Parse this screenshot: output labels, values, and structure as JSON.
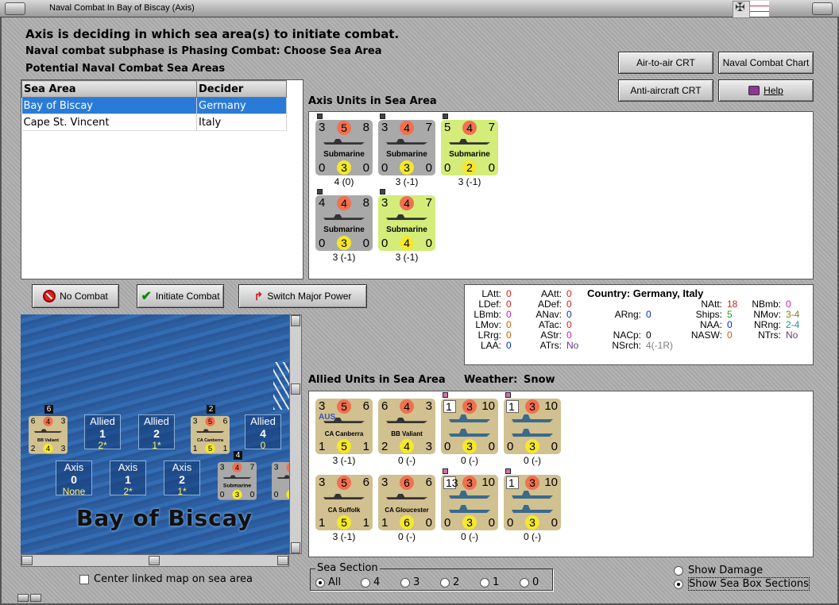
{
  "window": {
    "title": "Naval Combat In Bay of Biscay (Axis)"
  },
  "header": {
    "line1": "Axis is deciding in which sea area(s) to initiate combat.",
    "line2": "Naval combat subphase is Phasing Combat: Choose Sea Area",
    "line3": "Potential Naval Combat Sea Areas"
  },
  "crt_buttons": {
    "air_to_air": "Air-to-air CRT",
    "naval_chart": "Naval Combat Chart",
    "anti_aircraft": "Anti-aircraft CRT",
    "help": "Help"
  },
  "sea_table": {
    "headers": [
      "Sea Area",
      "Decider"
    ],
    "rows": [
      {
        "area": "Bay of Biscay",
        "decider": "Germany",
        "selected": true
      },
      {
        "area": "Cape St. Vincent",
        "decider": "Italy",
        "selected": false
      }
    ]
  },
  "axis_units": {
    "label": "Axis Units in Sea Area",
    "units": [
      {
        "color": "grey",
        "tl": "3",
        "top": "5",
        "tr": "8",
        "name": "Submarine",
        "bl": "0",
        "bottom": "3",
        "br": "0",
        "caption": "4 (0)"
      },
      {
        "color": "grey",
        "tl": "3",
        "top": "4",
        "tr": "7",
        "name": "Submarine",
        "bl": "0",
        "bottom": "3",
        "br": "0",
        "caption": "3 (-1)"
      },
      {
        "color": "lime",
        "tl": "5",
        "top": "4",
        "tr": "7",
        "name": "Submarine",
        "bl": "0",
        "bottom": "2",
        "br": "0",
        "caption": "3 (-1)"
      },
      {
        "color": "grey",
        "tl": "4",
        "top": "4",
        "tr": "8",
        "name": "Submarine",
        "bl": "0",
        "bottom": "3",
        "br": "0",
        "caption": "3 (-1)"
      },
      {
        "color": "lime",
        "tl": "3",
        "top": "4",
        "tr": "7",
        "name": "Submarine",
        "bl": "0",
        "bottom": "4",
        "br": "0",
        "caption": "3 (-1)"
      }
    ]
  },
  "action_buttons": {
    "no_combat": "No Combat",
    "initiate": "Initiate Combat",
    "switch": "Switch Major Power"
  },
  "stats": {
    "country": "Country: Germany, Italy",
    "col1": [
      {
        "k": "LAtt:",
        "v": "0",
        "c": "#d02020"
      },
      {
        "k": "LDef:",
        "v": "0",
        "c": "#d02020"
      },
      {
        "k": "LBmb:",
        "v": "0",
        "c": "#c020c0"
      },
      {
        "k": "LMov:",
        "v": "0",
        "c": "#c06000"
      },
      {
        "k": "LRrg:",
        "v": "0",
        "c": "#c06000"
      },
      {
        "k": "LAA:",
        "v": "0",
        "c": "#0030c0"
      }
    ],
    "col2": [
      {
        "k": "AAtt:",
        "v": "0",
        "c": "#d02020"
      },
      {
        "k": "ADef:",
        "v": "0",
        "c": "#d02020"
      },
      {
        "k": "ANav:",
        "v": "0",
        "c": "#0030c0"
      },
      {
        "k": "ATac:",
        "v": "0",
        "c": "#d02020"
      },
      {
        "k": "AStr:",
        "v": "0",
        "c": "#c020c0"
      },
      {
        "k": "ATrs:",
        "v": "No",
        "c": "#604080"
      }
    ],
    "col3": [
      {
        "k": "ARng:",
        "v": "0",
        "c": "#0030c0"
      },
      {
        "k": "NACp:",
        "v": "0",
        "c": "#000"
      },
      {
        "k": "NSrch:",
        "v": "4(-1R)",
        "c": "#808080"
      }
    ],
    "col4": [
      {
        "k": "NAtt:",
        "v": "18",
        "c": "#d02020"
      },
      {
        "k": "Ships:",
        "v": "5",
        "c": "#20a020"
      },
      {
        "k": "NAA:",
        "v": "0",
        "c": "#0030c0"
      },
      {
        "k": "NASW:",
        "v": "0",
        "c": "#c06000"
      }
    ],
    "col5": [
      {
        "k": "NBmb:",
        "v": "0",
        "c": "#c020c0"
      },
      {
        "k": "NMov:",
        "v": "3-4",
        "c": "#808020"
      },
      {
        "k": "NRng:",
        "v": "2-4",
        "c": "#209090"
      },
      {
        "k": "NTrs:",
        "v": "No",
        "c": "#604080"
      }
    ]
  },
  "allied_units": {
    "label": "Allied Units in Sea Area",
    "weather_label": "Weather:",
    "weather": "Snow",
    "units": [
      {
        "type": "ship",
        "tl": "3",
        "top": "5",
        "tr": "6",
        "name": "CA Canberra",
        "aus": "AUS",
        "bl": "1",
        "bottom": "5",
        "br": "1",
        "caption": "3 (-1)"
      },
      {
        "type": "ship",
        "tl": "6",
        "top": "4",
        "tr": "3",
        "name": "BB Valiant",
        "bl": "2",
        "bottom": "4",
        "br": "3",
        "caption": "0 (-)"
      },
      {
        "type": "convoy",
        "tl": "1",
        "top": "3",
        "tr": "10",
        "bl": "0",
        "bottom": "3",
        "br": "0",
        "caption": "0 (-)"
      },
      {
        "type": "convoy",
        "tl": "1",
        "top": "3",
        "tr": "10",
        "bl": "0",
        "bottom": "3",
        "br": "0",
        "caption": "0 (-)"
      },
      {
        "type": "ship",
        "tl": "3",
        "top": "5",
        "tr": "6",
        "name": "CA Suffolk",
        "bl": "1",
        "bottom": "5",
        "br": "1",
        "caption": "3 (-1)"
      },
      {
        "type": "ship",
        "tl": "3",
        "top": "6",
        "tr": "6",
        "name": "CA Gloucester",
        "bl": "1",
        "bottom": "6",
        "br": "0",
        "caption": "0 (-)"
      },
      {
        "type": "convoy",
        "tl": "13",
        "top": "3",
        "tr": "10",
        "bl": "0",
        "bottom": "3",
        "br": "0",
        "caption": "0 (-)"
      },
      {
        "type": "convoy",
        "tl": "1",
        "top": "3",
        "tr": "10",
        "bl": "0",
        "bottom": "3",
        "br": "0",
        "caption": "0 (-)"
      }
    ]
  },
  "map": {
    "title": "Bay of Biscay",
    "allied_boxes": [
      {
        "label": "Allied",
        "n": "1",
        "s": "2*"
      },
      {
        "label": "Allied",
        "n": "2",
        "s": "1*"
      },
      {
        "label": "Allied",
        "n": "4",
        "s": "0"
      }
    ],
    "axis_boxes": [
      {
        "label": "Axis",
        "n": "0",
        "s": "None"
      },
      {
        "label": "Axis",
        "n": "1",
        "s": "2*"
      },
      {
        "label": "Axis",
        "n": "2",
        "s": "1*"
      }
    ],
    "stack_badges": [
      "6",
      "2",
      "4"
    ],
    "mini_counters": [
      {
        "tl": "6",
        "top": "4",
        "tr": "3",
        "name": "BB Valiant",
        "bl": "2",
        "bottom": "4",
        "br": "3"
      },
      {
        "tl": "3",
        "top": "5",
        "tr": "6",
        "name": "CA Canberra",
        "bl": "1",
        "bottom": "5",
        "br": "1"
      },
      {
        "tl": "3",
        "top": "4",
        "tr": "7",
        "name": "Submarine",
        "bl": "0",
        "bottom": "3",
        "br": "0"
      },
      {
        "tl": "3",
        "top": "",
        "tr": "",
        "name": "S",
        "bl": "0",
        "bottom": "",
        "br": ""
      }
    ],
    "center_linked": "Center linked map on sea area"
  },
  "sea_section": {
    "label": "Sea Section",
    "options": [
      "All",
      "4",
      "3",
      "2",
      "1",
      "0"
    ],
    "selected": "All"
  },
  "show_damage": "Show Damage",
  "show_sections": "Show Sea Box Sections"
}
